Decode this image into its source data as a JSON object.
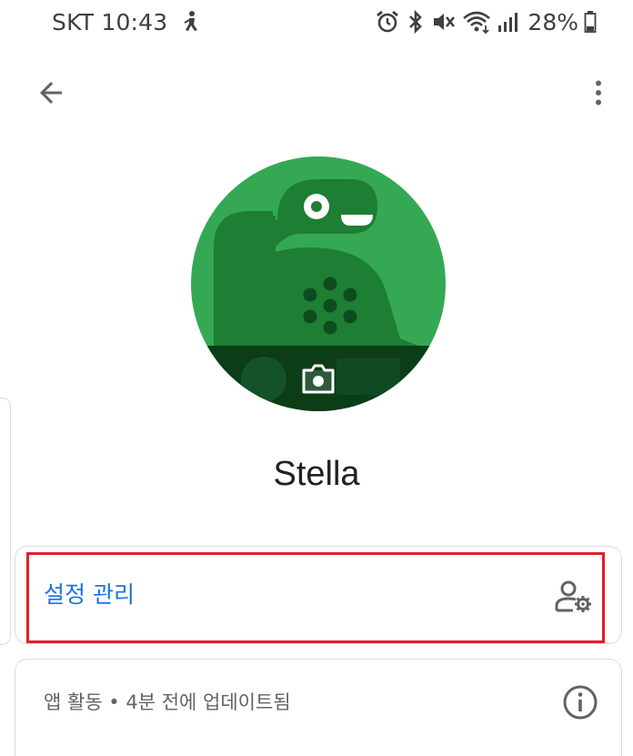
{
  "status_bar": {
    "carrier_time": "SKT 10:43",
    "battery": "28%",
    "icons": [
      "person-walk-icon",
      "alarm-icon",
      "bluetooth-icon",
      "vibrate-mute-icon",
      "wifi-icon",
      "signal-icon",
      "battery-icon"
    ]
  },
  "app_bar": {
    "back_icon": "arrow-back-icon",
    "more_icon": "more-vert-icon"
  },
  "profile": {
    "name": "Stella",
    "avatar_icon": "dinosaur-avatar",
    "camera_icon": "camera-icon",
    "avatar_color": "#34a853"
  },
  "settings_card": {
    "label": "설정 관리",
    "icon": "manage-accounts-icon"
  },
  "activity_card": {
    "text": "앱 활동 • 4분 전에 업데이트됨",
    "icon": "info-icon"
  },
  "colors": {
    "accent": "#1a73e8",
    "highlight": "#e0202a",
    "border": "#dadce0"
  }
}
